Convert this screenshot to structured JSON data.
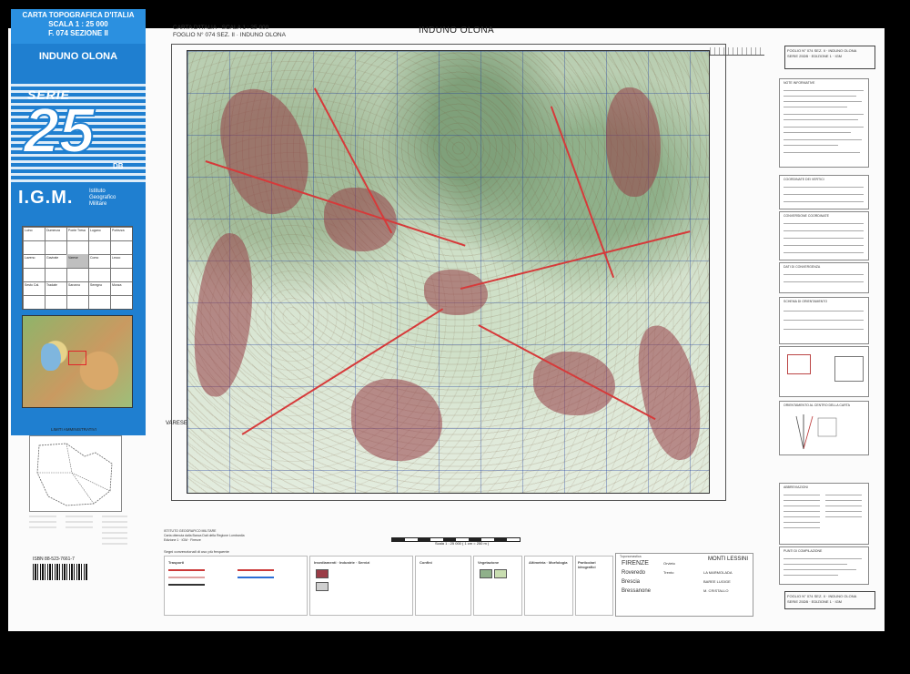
{
  "sheet": {
    "header_lines": [
      "CARTA TOPOGRAFICA D'ITALIA",
      "SCALA  1 : 25 000",
      "F. 074 SEZIONE II"
    ],
    "place_name": "INDUNO OLONA",
    "series_label": "SERIE",
    "series_number": "25",
    "series_edition": "DB",
    "publisher_abbrev": "I.G.M.",
    "publisher_full": [
      "Istituto",
      "Geografico",
      "Militare"
    ],
    "admin_title": "LIMITI AMMINISTRATIVI",
    "isbn": "ISBN 88-523-7661-7"
  },
  "index_map": {
    "labels": [
      "Luino",
      "Dumenza",
      "Ponte Tresa",
      "Lugano",
      "Porlezza",
      "Laveno",
      "Gavirate",
      "Varese",
      "Como",
      "Lecco",
      "Sesto Cal.",
      "Tradate",
      "Saronno",
      "Seregno",
      "Monza"
    ]
  },
  "map": {
    "header_left": [
      "CARTA D'ITALIA · SCALA 1 : 25 000",
      "FOGLIO N° 074 SEZ. II · INDUNO OLONA"
    ],
    "header_center": "INDUNO OLONA",
    "places": [
      "VARESE"
    ],
    "scale_note": "Scala 1 : 25 000 ( 1 cm = 250 m )",
    "publisher_note": [
      "ISTITUTO GEOGRAFICO MILITARE",
      "Carta ottenuta dalla Banca Dati della Regione Lombardia",
      "Edizione 1 · IGM · Firenze"
    ],
    "legend_heading": "Segni convenzionali di uso più frequente"
  },
  "legend": {
    "sections": [
      "Trasporti",
      "Insediamenti · Industrie · Servizi",
      "Confini",
      "Vegetazione",
      "Altimetria · Morfologia",
      "Particolari idrografici",
      "Toponomastica"
    ],
    "toponyms": [
      "FIRENZE",
      "Roveredo",
      "Brescia",
      "Bressanone",
      "Orvieto",
      "LA MARMOLADA",
      "BAREE LUGIGE",
      "M. CRISTALLO",
      "Trento"
    ],
    "monti": "MONTI LESSINI"
  },
  "right_panel": {
    "header": [
      "FOGLIO N° 074 SEZ. II · INDUNO OLONA",
      "SERIE 25DB · EDIZIONE 1 · IGM"
    ],
    "blocks": [
      "NOTE INFORMATIVE",
      "COORDINATE DEI VERTICI",
      "CONVERSIONE COORDINATE",
      "DATI DI CONVERGENZA",
      "SCHEMA DI ORIENTAMENTO",
      "ORIENTAMENTO AL CENTRO DELLA CARTA",
      "ABBREVIAZIONI",
      "PUNTI DI COMPILAZIONE"
    ],
    "footer": [
      "FOGLIO N° 074 SEZ. II · INDUNO OLONA",
      "SERIE 25DB · EDIZIONE 1 · IGM"
    ]
  },
  "colors": {
    "band_blue": "#1f7fd0",
    "urban": "#9a3c46",
    "road_red": "#d63a3a",
    "grid_blue": "#2a4ea0",
    "forest": "#8fb08a"
  }
}
